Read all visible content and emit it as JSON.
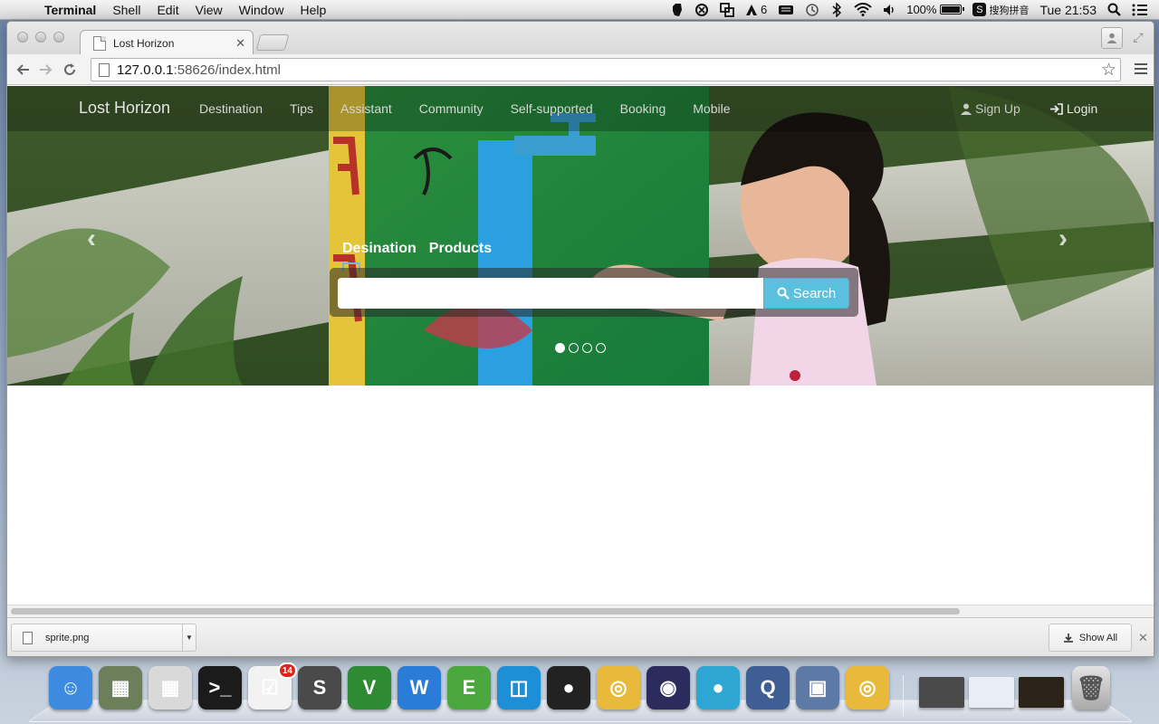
{
  "menubar": {
    "app": "Terminal",
    "items": [
      "Shell",
      "Edit",
      "View",
      "Window",
      "Help"
    ],
    "status": {
      "adobe_count": "6",
      "battery": "100%",
      "input_method": "搜狗拼音",
      "clock": "Tue 21:53"
    }
  },
  "browser": {
    "tab_title": "Lost Horizon",
    "url_host": "127.0.0.1",
    "url_rest": ":58626/index.html"
  },
  "site": {
    "brand": "Lost Horizon",
    "nav": [
      "Destination",
      "Tips",
      "Assistant",
      "Community",
      "Self-supported",
      "Booking",
      "Mobile"
    ],
    "signup": "Sign Up",
    "login": "Login",
    "search_tabs": [
      "Desination",
      "Products"
    ],
    "search_value": "",
    "search_button": "Search",
    "carousel": {
      "slides": 4,
      "active": 0
    }
  },
  "downloads": {
    "file": "sprite.png",
    "show_all": "Show All"
  },
  "dock": {
    "items": [
      {
        "name": "finder",
        "color": "#3d8be0",
        "glyph": "☺"
      },
      {
        "name": "preview-app",
        "color": "#6a7f5a",
        "glyph": "▦"
      },
      {
        "name": "calculator",
        "color": "#d9d9d9",
        "glyph": "▦"
      },
      {
        "name": "terminal",
        "color": "#1b1b1b",
        "glyph": ">_"
      },
      {
        "name": "reminders",
        "color": "#f2f2f2",
        "glyph": "☑",
        "badge": "14"
      },
      {
        "name": "sublime-text",
        "color": "#4a4a4a",
        "glyph": "S"
      },
      {
        "name": "vim",
        "color": "#2f8a34",
        "glyph": "V"
      },
      {
        "name": "wunderlist",
        "color": "#2b7bd8",
        "glyph": "W"
      },
      {
        "name": "evernote",
        "color": "#4ba83e",
        "glyph": "E"
      },
      {
        "name": "sequel",
        "color": "#1c8fd6",
        "glyph": "◫"
      },
      {
        "name": "qq",
        "color": "#222",
        "glyph": "●"
      },
      {
        "name": "chrome",
        "color": "#e8b93a",
        "glyph": "◎"
      },
      {
        "name": "eclipse",
        "color": "#2c2b5e",
        "glyph": "◉"
      },
      {
        "name": "screen-recorder",
        "color": "#2ea6d4",
        "glyph": "●"
      },
      {
        "name": "quicktime",
        "color": "#3f5f94",
        "glyph": "Q"
      },
      {
        "name": "iphoto",
        "color": "#5d7aa6",
        "glyph": "▣"
      },
      {
        "name": "chrome-2",
        "color": "#e8b93a",
        "glyph": "◎"
      }
    ]
  }
}
